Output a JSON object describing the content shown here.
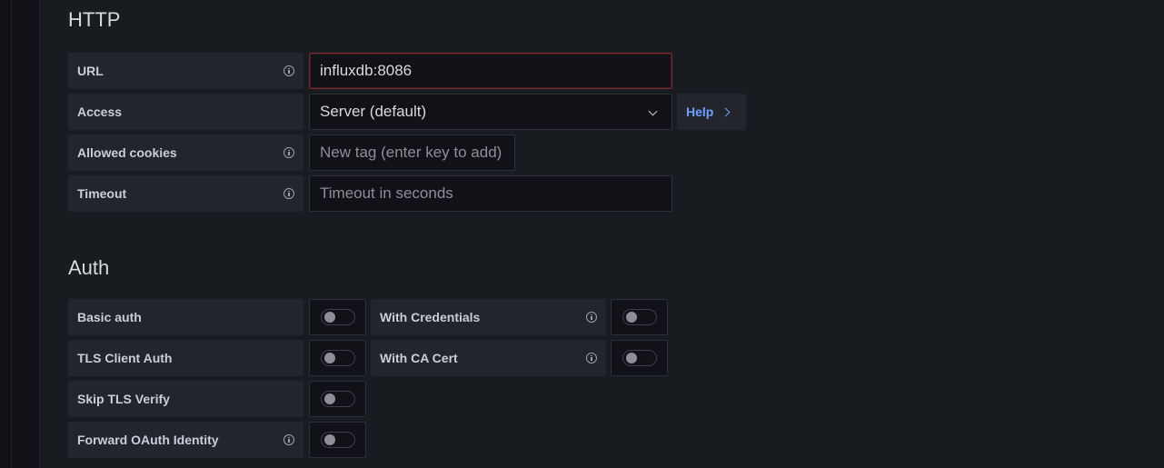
{
  "http": {
    "title": "HTTP",
    "url": {
      "label": "URL",
      "value": "influxdb:8086"
    },
    "access": {
      "label": "Access",
      "value": "Server (default)",
      "help_label": "Help"
    },
    "allowed_cookies": {
      "label": "Allowed cookies",
      "placeholder": "New tag (enter key to add)"
    },
    "timeout": {
      "label": "Timeout",
      "placeholder": "Timeout in seconds"
    }
  },
  "auth": {
    "title": "Auth",
    "basic_auth": {
      "label": "Basic auth",
      "enabled": false
    },
    "with_credentials": {
      "label": "With Credentials",
      "enabled": false
    },
    "tls_client_auth": {
      "label": "TLS Client Auth",
      "enabled": false
    },
    "with_ca_cert": {
      "label": "With CA Cert",
      "enabled": false
    },
    "skip_tls_verify": {
      "label": "Skip TLS Verify",
      "enabled": false
    },
    "forward_oauth": {
      "label": "Forward OAuth Identity",
      "enabled": false
    }
  },
  "colors": {
    "background": "#111217",
    "panel": "#181b1f",
    "label_bg": "#22252b",
    "link": "#6e9fff",
    "invalid_border": "#7a2a2e"
  }
}
